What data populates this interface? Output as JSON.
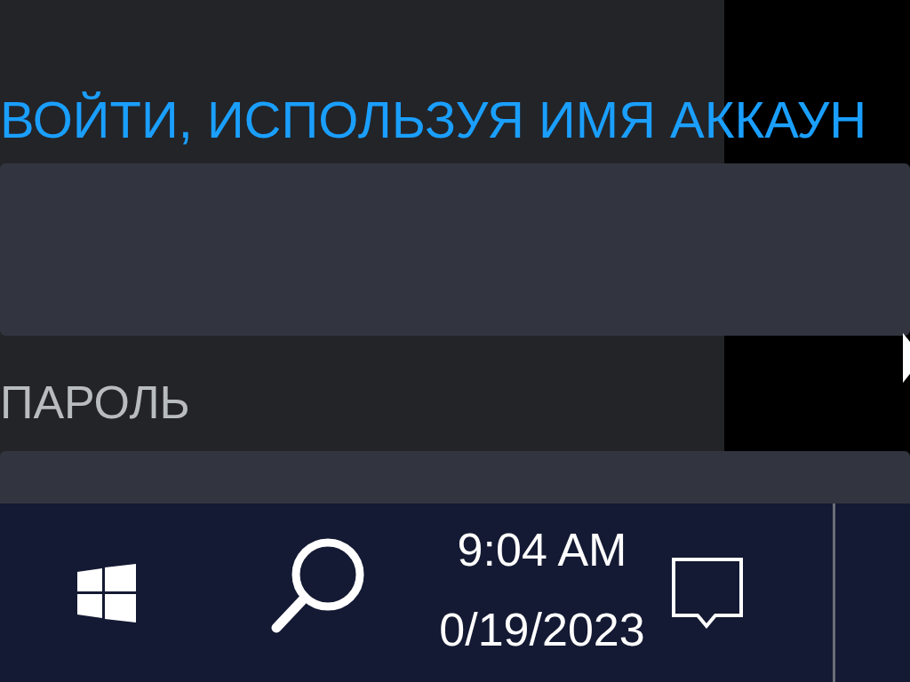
{
  "login": {
    "account_link": "ВОЙТИ, ИСПОЛЬЗУЯ ИМЯ АККАУН",
    "password_label": "ПАРОЛЬ"
  },
  "taskbar": {
    "time": "9:04 AM",
    "date": "0/19/2023"
  }
}
